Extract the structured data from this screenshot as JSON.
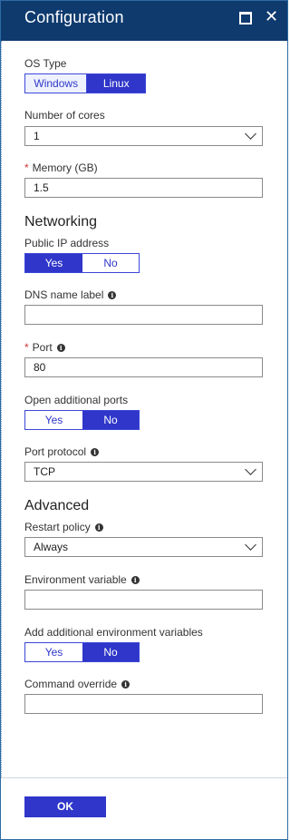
{
  "header": {
    "title": "Configuration"
  },
  "os_type": {
    "label": "OS Type",
    "options": [
      "Windows",
      "Linux"
    ],
    "selected": "Linux"
  },
  "cores": {
    "label": "Number of cores",
    "value": "1"
  },
  "memory": {
    "label": "Memory (GB)",
    "value": "1.5",
    "required": "*"
  },
  "networking": {
    "title": "Networking"
  },
  "public_ip": {
    "label": "Public IP address",
    "yes": "Yes",
    "no": "No",
    "selected": "Yes"
  },
  "dns": {
    "label": "DNS name label",
    "value": ""
  },
  "port": {
    "label": "Port",
    "value": "80",
    "required": "*"
  },
  "open_ports": {
    "label": "Open additional ports",
    "yes": "Yes",
    "no": "No",
    "selected": "No"
  },
  "protocol": {
    "label": "Port protocol",
    "value": "TCP"
  },
  "advanced": {
    "title": "Advanced"
  },
  "restart": {
    "label": "Restart policy",
    "value": "Always"
  },
  "env_var": {
    "label": "Environment variable",
    "value": ""
  },
  "add_env": {
    "label": "Add additional environment variables",
    "yes": "Yes",
    "no": "No",
    "selected": "No"
  },
  "command": {
    "label": "Command override",
    "value": ""
  },
  "footer": {
    "ok_label": "OK"
  },
  "info_glyph": "i",
  "colors": {
    "header": "#0e3a6e",
    "accent": "#2f36c9",
    "required": "#d13438"
  }
}
